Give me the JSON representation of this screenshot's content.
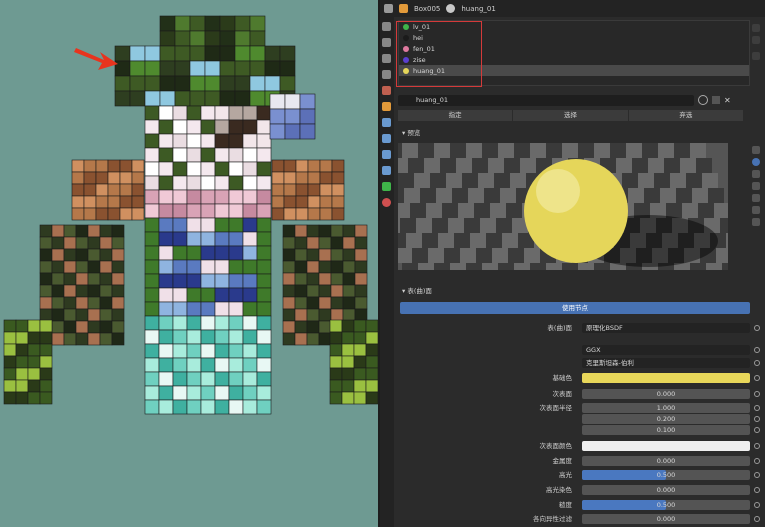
{
  "header": {
    "object_name": "Box005",
    "material_name": "huang_01"
  },
  "slots": [
    {
      "name": "lv_01",
      "color": "#3fb44a"
    },
    {
      "name": "hei",
      "color": "#1b1b1b"
    },
    {
      "name": "fen_01",
      "color": "#e07aa0"
    },
    {
      "name": "zise",
      "color": "#5a3fd0"
    },
    {
      "name": "huang_01",
      "color": "#e5d65a"
    }
  ],
  "material": {
    "name": "huang_01",
    "buttons": [
      "指定",
      "选择",
      "弃选"
    ]
  },
  "sections": {
    "preview": "预览",
    "surface": "表(曲)面"
  },
  "use_nodes_label": "使用节点",
  "properties": [
    {
      "label": "表(曲)面",
      "value": "原理化BSDF",
      "style": "dark"
    },
    {
      "label": "",
      "value": "GGX",
      "style": "dark"
    },
    {
      "label": "",
      "value": "克里斯坦森-伯利",
      "style": "dark"
    },
    {
      "label": "基础色",
      "value": "",
      "color": "#e8d75a"
    },
    {
      "label": "次表面",
      "value": "0.000"
    },
    {
      "label": "次表面半径",
      "value": "1.000"
    },
    {
      "label": "",
      "value": "0.200"
    },
    {
      "label": "",
      "value": "0.100"
    },
    {
      "label": "次表面颜色",
      "value": "",
      "color": "#efefef"
    },
    {
      "label": "金属度",
      "value": "0.000"
    },
    {
      "label": "高光",
      "value": "0.500",
      "fill": 0.5
    },
    {
      "label": "高光染色",
      "value": "0.000"
    },
    {
      "label": "糙度",
      "value": "0.500",
      "fill": 0.5
    },
    {
      "label": "各向异性过滤",
      "value": "0.000"
    }
  ]
}
